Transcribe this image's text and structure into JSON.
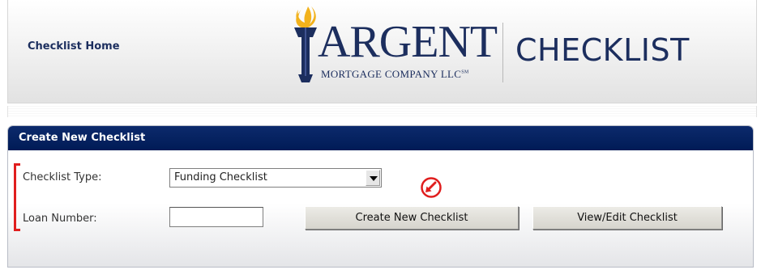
{
  "header": {
    "home_link": "Checklist Home",
    "brand_name": "ARGENT",
    "brand_sub": "MORTGAGE COMPANY LLC",
    "brand_tm": "SM",
    "product": "CHECKLIST"
  },
  "panel": {
    "title": "Create New Checklist",
    "type_label": "Checklist Type:",
    "type_value": "Funding Checklist",
    "loan_label": "Loan Number:",
    "loan_value": "",
    "create_button": "Create New Checklist",
    "view_button": "View/Edit Checklist"
  },
  "colors": {
    "navy": "#1c2e5e",
    "title_bar": "#0c2a6c",
    "annotation_red": "#e01e1e",
    "torch_flame": "#f2b21c"
  },
  "icons": {
    "torch": "torch-icon",
    "annotation": "circled-arrow-icon",
    "dropdown": "chevron-down-icon"
  }
}
